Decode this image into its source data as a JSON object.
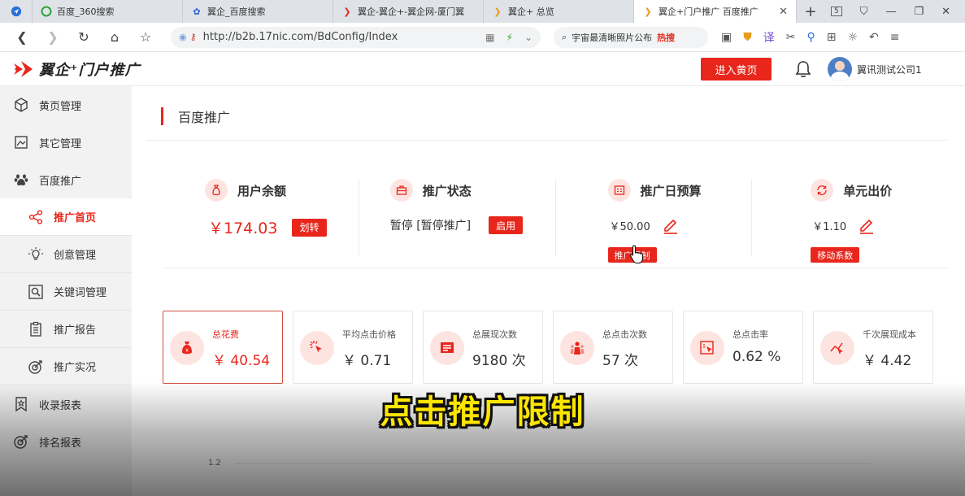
{
  "browser": {
    "tabs": [
      {
        "label": ""
      },
      {
        "label": "百度_360搜索"
      },
      {
        "label": "翼企_百度搜索"
      },
      {
        "label": "翼企-翼企+-翼企网-厦门翼"
      },
      {
        "label": "翼企+ 总览"
      },
      {
        "label": "翼企+门户推广 百度推广"
      }
    ],
    "tab_count_badge": "5",
    "url_prefix": "http://",
    "url": "b2b.17nic.com/BdConfig/Index",
    "search_text": "宇宙最清晰照片公布",
    "search_hot": "热搜"
  },
  "header": {
    "logo_text": "翼企⁺门户推广",
    "enter_button": "进入黄页",
    "user_name": "翼讯测试公司1"
  },
  "sidebar": {
    "items": [
      {
        "label": "黄页管理"
      },
      {
        "label": "其它管理"
      },
      {
        "label": "百度推广"
      },
      {
        "label": "推广首页"
      },
      {
        "label": "创意管理"
      },
      {
        "label": "关键词管理"
      },
      {
        "label": "推广报告"
      },
      {
        "label": "推广实况"
      },
      {
        "label": "收录报表"
      },
      {
        "label": "排名报表"
      }
    ]
  },
  "main": {
    "title": "百度推广",
    "stats": {
      "balance": {
        "label": "用户余额",
        "value": "￥174.03",
        "button": "划转"
      },
      "status": {
        "label": "推广状态",
        "value": "暂停 [暂停推广]",
        "button": "启用"
      },
      "budget": {
        "label": "推广日预算",
        "value": "￥50.00",
        "button": "推广限制"
      },
      "bid": {
        "label": "单元出价",
        "value": "￥1.10",
        "button": "移动系数"
      }
    },
    "cards": [
      {
        "label": "总花费",
        "value": "￥ 40.54"
      },
      {
        "label": "平均点击价格",
        "value": "￥ 0.71"
      },
      {
        "label": "总展现次数",
        "value": "9180 次"
      },
      {
        "label": "总点击次数",
        "value": "57 次"
      },
      {
        "label": "总点击率",
        "value": "0.62 %"
      },
      {
        "label": "千次展现成本",
        "value": "￥ 4.42"
      }
    ],
    "chart_tick": "1.2"
  },
  "overlay": {
    "subtitle": "点击推广限制"
  },
  "colors": {
    "accent": "#e8261c",
    "icon_bg": "#fde4e1",
    "subtitle": "#ffe600"
  }
}
